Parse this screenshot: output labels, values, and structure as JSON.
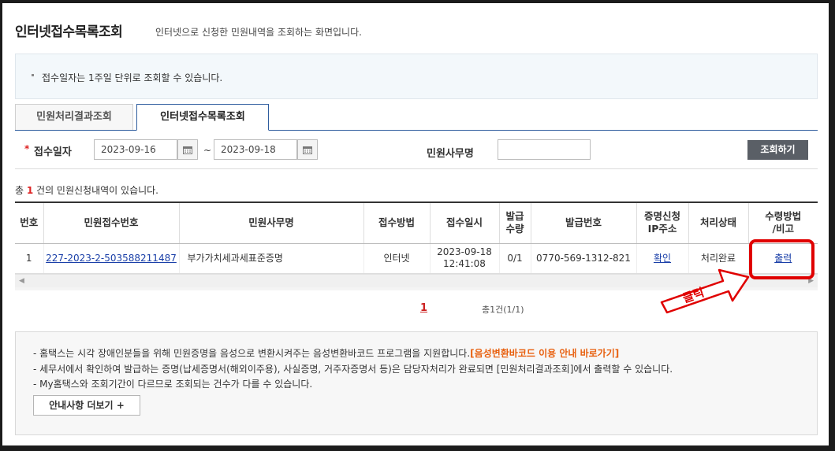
{
  "header": {
    "title": "인터넷접수목록조회",
    "subtitle": "인터넷으로 신청한 민원내역을 조회하는 화면입니다."
  },
  "notice": "접수일자는 1주일 단위로 조회할 수 있습니다.",
  "tabs": [
    {
      "label": "민원처리결과조회",
      "active": false
    },
    {
      "label": "인터넷접수목록조회",
      "active": true
    }
  ],
  "filter": {
    "required_mark": "*",
    "date_label": "접수일자",
    "start_date": "2023-09-16",
    "separator": "~",
    "end_date": "2023-09-18",
    "office_label": "민원사무명",
    "office_value": "",
    "search_button": "조회하기"
  },
  "result_summary": {
    "prefix": "총 ",
    "count": "1",
    "suffix": " 건의 민원신청내역이 있습니다."
  },
  "table": {
    "headers": {
      "no": "번호",
      "receipt_no": "민원접수번호",
      "office_name": "민원사무명",
      "method": "접수방법",
      "datetime": "접수일시",
      "qty_1": "발급",
      "qty_2": "수량",
      "issue_no": "발급번호",
      "ip_1": "증명신청",
      "ip_2": "IP주소",
      "status": "처리상태",
      "receive_1": "수령방법",
      "receive_2": "/비고"
    },
    "rows": [
      {
        "no": "1",
        "receipt_no": "227-2023-2-503588211487",
        "office_name": "부가가치세과세표준증명",
        "method": "인터넷",
        "date": "2023-09-18",
        "time": "12:41:08",
        "qty": "0/1",
        "issue_no": "0770-569-1312-821",
        "ip": "확인",
        "status": "처리완료",
        "receive": "출력"
      }
    ]
  },
  "annotation": {
    "text": "클릭",
    "color": "#e00000"
  },
  "pagination": {
    "current": "1",
    "info": "총1건(1/1)"
  },
  "info": {
    "line1_text": "- 홈택스는 시각 장애인분들을 위해 민원증명을 음성으로 변환시켜주는 음성변환바코드 프로그램을 지원합니다.",
    "line1_link": "[음성변환바코드 이용 안내 바로가기]",
    "line2": "- 세무서에서 확인하여 발급하는 증명(납세증명서(해외이주용), 사실증명, 거주자증명서 등)은 담당자처리가 완료되면 [민원처리결과조회]에서 출력할 수 있습니다.",
    "line3": "- My홈택스와 조회기간이 다르므로 조회되는 건수가 다를 수 있습니다.",
    "more_button": "안내사항 더보기 +"
  },
  "colors": {
    "accent_border": "#2f5d9e",
    "link": "#1a3fa8",
    "highlight_orange": "#e8600f",
    "button_dark": "#5a5f66"
  }
}
